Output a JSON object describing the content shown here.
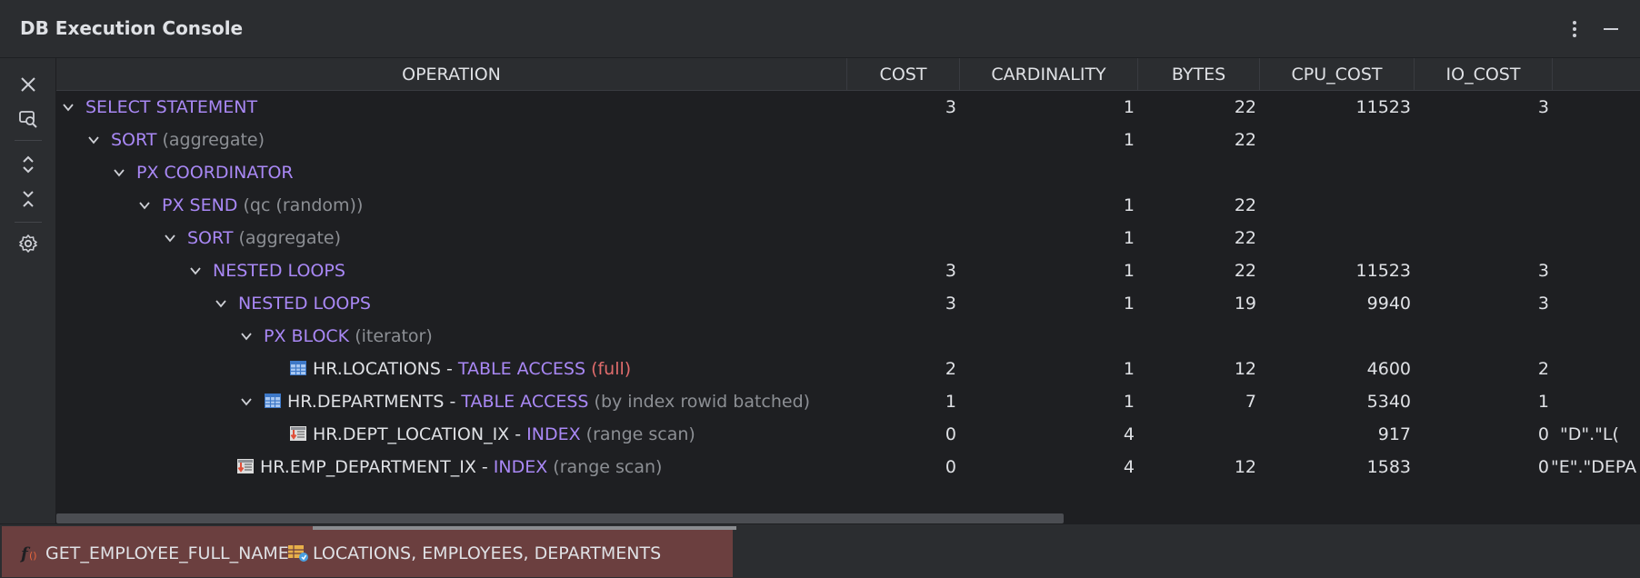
{
  "window": {
    "title": "DB Execution Console"
  },
  "toolbar": {
    "icons": [
      "close-icon",
      "find-icon",
      "expand-all-icon",
      "collapse-all-icon",
      "gear-icon"
    ]
  },
  "table": {
    "columns": [
      "OPERATION",
      "COST",
      "CARDINALITY",
      "BYTES",
      "CPU_COST",
      "IO_COST"
    ],
    "rows": [
      {
        "keyword": "SELECT STATEMENT",
        "object": "",
        "sep": "",
        "detail": "",
        "cost": "3",
        "cardinality": "1",
        "bytes": "22",
        "cpu_cost": "11523",
        "io_cost": "3",
        "extra": ""
      },
      {
        "keyword": "SORT",
        "object": "",
        "sep": "",
        "detail": "(aggregate)",
        "cost": "",
        "cardinality": "1",
        "bytes": "22",
        "cpu_cost": "",
        "io_cost": "",
        "extra": ""
      },
      {
        "keyword": "PX COORDINATOR",
        "object": "",
        "sep": "",
        "detail": "",
        "cost": "",
        "cardinality": "",
        "bytes": "",
        "cpu_cost": "",
        "io_cost": "",
        "extra": ""
      },
      {
        "keyword": "PX SEND",
        "object": "",
        "sep": "",
        "detail": "(qc (random))",
        "cost": "",
        "cardinality": "1",
        "bytes": "22",
        "cpu_cost": "",
        "io_cost": "",
        "extra": ""
      },
      {
        "keyword": "SORT",
        "object": "",
        "sep": "",
        "detail": "(aggregate)",
        "cost": "",
        "cardinality": "1",
        "bytes": "22",
        "cpu_cost": "",
        "io_cost": "",
        "extra": ""
      },
      {
        "keyword": "NESTED LOOPS",
        "object": "",
        "sep": "",
        "detail": "",
        "cost": "3",
        "cardinality": "1",
        "bytes": "22",
        "cpu_cost": "11523",
        "io_cost": "3",
        "extra": ""
      },
      {
        "keyword": "NESTED LOOPS",
        "object": "",
        "sep": "",
        "detail": "",
        "cost": "3",
        "cardinality": "1",
        "bytes": "19",
        "cpu_cost": "9940",
        "io_cost": "3",
        "extra": ""
      },
      {
        "keyword": "PX BLOCK",
        "object": "",
        "sep": "",
        "detail": "(iterator)",
        "cost": "",
        "cardinality": "",
        "bytes": "",
        "cpu_cost": "",
        "io_cost": "",
        "extra": ""
      },
      {
        "keyword": "TABLE ACCESS",
        "object": "HR.LOCATIONS",
        "sep": " - ",
        "detail": "(full)",
        "cost": "2",
        "cardinality": "1",
        "bytes": "12",
        "cpu_cost": "4600",
        "io_cost": "2",
        "extra": ""
      },
      {
        "keyword": "TABLE ACCESS",
        "object": "HR.DEPARTMENTS",
        "sep": " - ",
        "detail": "(by index rowid batched)",
        "cost": "1",
        "cardinality": "1",
        "bytes": "7",
        "cpu_cost": "5340",
        "io_cost": "1",
        "extra": ""
      },
      {
        "keyword": "INDEX",
        "object": "HR.DEPT_LOCATION_IX",
        "sep": " - ",
        "detail": "(range scan)",
        "cost": "0",
        "cardinality": "4",
        "bytes": "",
        "cpu_cost": "917",
        "io_cost": "0",
        "extra": "\"D\".\"L("
      },
      {
        "keyword": "INDEX",
        "object": "HR.EMP_DEPARTMENT_IX",
        "sep": " - ",
        "detail": "(range scan)",
        "cost": "0",
        "cardinality": "4",
        "bytes": "12",
        "cpu_cost": "1583",
        "io_cost": "0",
        "extra": "\"E\".\"DEPA"
      }
    ]
  },
  "bottom_tabs": [
    {
      "label": "GET_EMPLOYEE_FULL_NAME",
      "icon": "function-icon"
    },
    {
      "label": "LOCATIONS, EMPLOYEES, DEPARTMENTS",
      "icon": "table-query-icon"
    }
  ]
}
